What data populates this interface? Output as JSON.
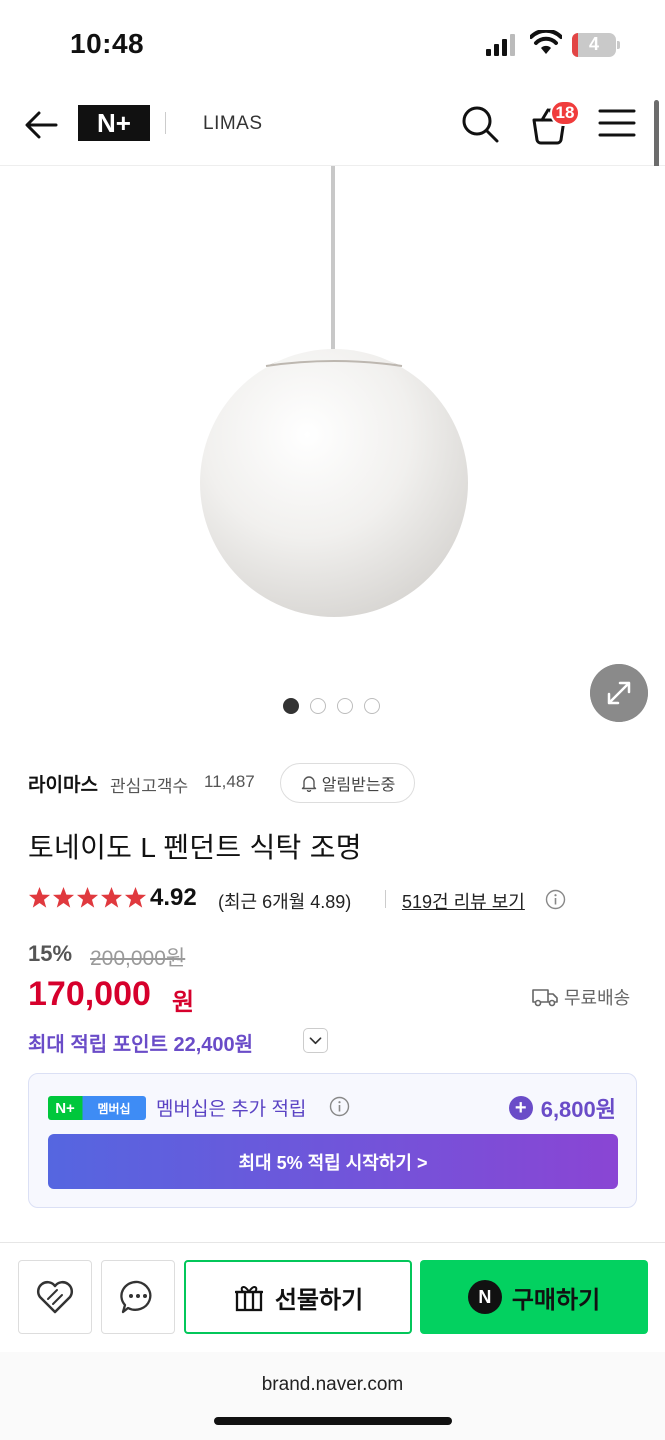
{
  "status_bar": {
    "time": "10:48",
    "battery_level": "4"
  },
  "header": {
    "logo_text": "N+",
    "brand": "LIMAS",
    "cart_count": "18"
  },
  "gallery": {
    "image_count": 4,
    "active_index": 0
  },
  "seller": {
    "name": "라이마스",
    "follower_label": "관심고객수",
    "follower_count": "11,487",
    "notify_label": "알림받는중"
  },
  "product": {
    "title": "토네이도 L 펜던트 식탁 조명",
    "rating": "4.92",
    "rating_recent": "(최근 6개월 4.89)",
    "review_link": "519건 리뷰 보기",
    "star_count": 5,
    "discount_rate": "15%",
    "original_price": "200,000원",
    "sale_price": "170,000",
    "currency": "원",
    "shipping": "무료배송",
    "points": "최대 적립 포인트 22,400원"
  },
  "membership": {
    "badge_n": "N+",
    "badge_label": "멤버십",
    "text": "멤버십은 추가 적립",
    "bonus": "6,800원",
    "cta": "최대 5% 적립 시작하기 >"
  },
  "actions": {
    "gift": "선물하기",
    "buy": "구매하기",
    "npay": "N"
  },
  "browser": {
    "url": "brand.naver.com"
  },
  "colors": {
    "sale_red": "#d6002c",
    "points_purple": "#6a4cc8",
    "naver_green": "#03d160",
    "star_red": "#e0393e"
  }
}
